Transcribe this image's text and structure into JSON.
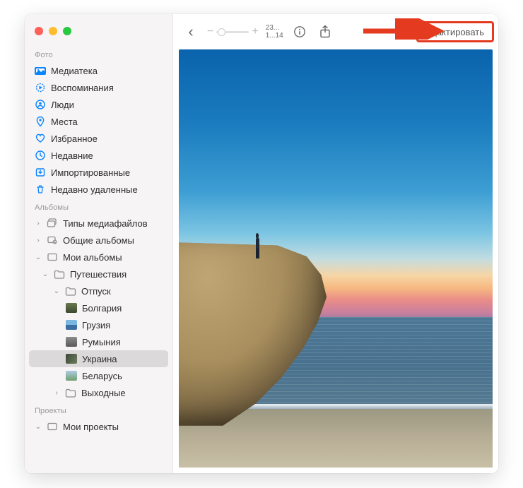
{
  "sidebar": {
    "section_photo": "Фото",
    "library": "Медиатека",
    "memories": "Воспоминания",
    "people": "Люди",
    "places": "Места",
    "favorites": "Избранное",
    "recent": "Недавние",
    "imported": "Импортированные",
    "deleted": "Недавно удаленные",
    "section_albums": "Альбомы",
    "media_types": "Типы медиафайлов",
    "shared_albums": "Общие альбомы",
    "my_albums": "Мои альбомы",
    "travels": "Путешествия",
    "vacation": "Отпуск",
    "bulgaria": "Болгария",
    "georgia": "Грузия",
    "romania": "Румыния",
    "ukraine": "Украина",
    "belarus": "Беларусь",
    "weekends": "Выходные",
    "section_projects": "Проекты",
    "my_projects": "Мои проекты"
  },
  "toolbar": {
    "counter_top": "23...",
    "counter_bottom": "1...14",
    "zoom_minus": "−",
    "zoom_plus": "+",
    "edit_label": "Редактировать"
  },
  "glyphs": {
    "back": "‹",
    "chev_right": "›",
    "chev_down": "⌄"
  }
}
